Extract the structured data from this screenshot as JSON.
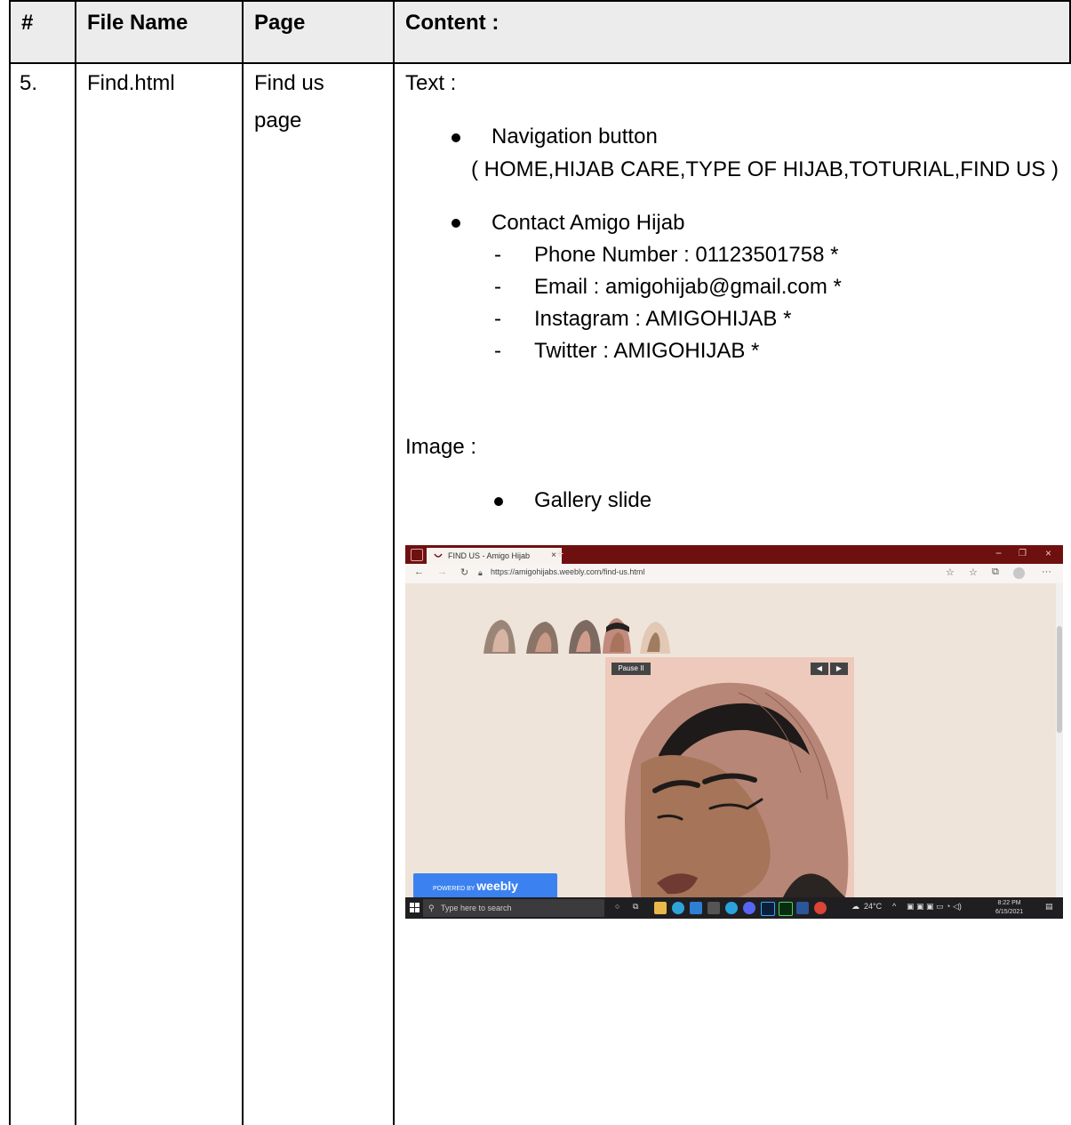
{
  "table": {
    "headers": [
      "#",
      "File Name",
      "Page",
      "Content :"
    ],
    "row": {
      "number": "5.",
      "file_name": "Find.html",
      "page_line1": "Find us",
      "page_line2": "page"
    }
  },
  "content": {
    "text_heading": "Text :",
    "nav_bullet": "Navigation button",
    "nav_items": "( HOME,HIJAB CARE,TYPE OF HIJAB,TOTURIAL,FIND US )",
    "contact_bullet": "Contact Amigo Hijab",
    "contacts": [
      "Phone Number : 01123501758 *",
      "Email : amigohijab@gmail.com *",
      "Instagram : AMIGOHIJAB *",
      "Twitter : AMIGOHIJAB *"
    ],
    "image_heading": "Image :",
    "gallery_bullet": "Gallery slide"
  },
  "screenshot": {
    "tab_title": "FIND US - Amigo Hijab",
    "url": "https://amigohijabs.weebly.com/find-us.html",
    "pause_label": "Pause II",
    "weebly_prefix": "POWERED BY",
    "weebly_brand": "weebly",
    "taskbar_search": "Type here to search",
    "weather": "24°C",
    "clock_time": "8:22 PM",
    "clock_date": "6/15/2021"
  },
  "colors": {
    "header_bg": "#ececec",
    "browser_titlebar": "#6e1010",
    "page_bg": "#efe4d9",
    "weebly_blue": "#3b82f0"
  }
}
